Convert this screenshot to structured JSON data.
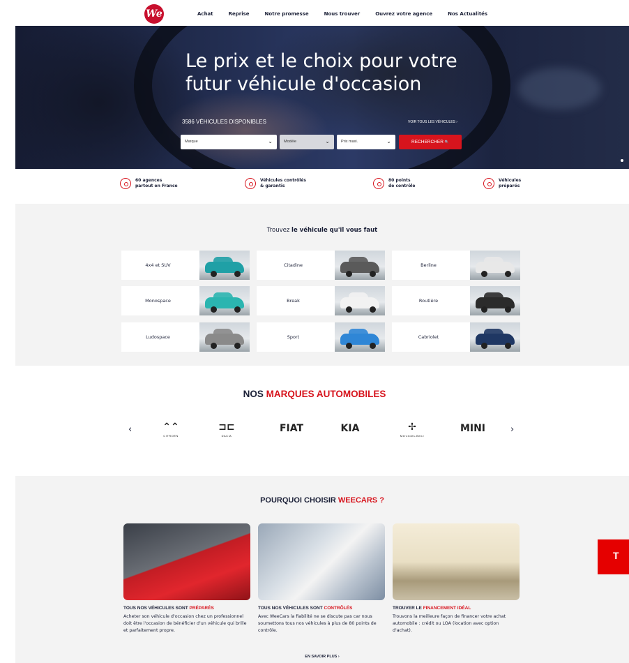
{
  "header": {
    "logo_text": "We",
    "nav": [
      "Achat",
      "Reprise",
      "Notre promesse",
      "Nous trouver",
      "Ouvrez votre agence",
      "Nos Actualités"
    ]
  },
  "hero": {
    "title": "Le prix et le choix pour votre\nfutur véhicule d'occasion",
    "count_label": "3586 VÉHICULES DISPONIBLES",
    "see_all_label": "VOIR TOUS LES VÉHICULES ›",
    "filters": {
      "brand": "Marque",
      "model": "Modèle",
      "max_price": "Prix maxi."
    },
    "search_label": "RECHERCHER",
    "search_icon": "🔍"
  },
  "features": [
    {
      "icon": "target-icon",
      "text": "60 agences\npartout en France"
    },
    {
      "icon": "check-circle-icon",
      "text": "Véhicules contrôlés\n& garantis"
    },
    {
      "icon": "gauge-icon",
      "text": "80 points\nde contrôle"
    },
    {
      "icon": "car-sparkle-icon",
      "text": "Véhicules\npréparés"
    }
  ],
  "categories": {
    "title_plain": "Trouvez ",
    "title_bold": "le véhicule qu'il vous faut",
    "items": [
      {
        "label": "4x4 et SUV",
        "color": "#1fa0a6"
      },
      {
        "label": "Citadine",
        "color": "#5a5a5a"
      },
      {
        "label": "Berline",
        "color": "#e8e8e8"
      },
      {
        "label": "Monospace",
        "color": "#2bb5b0"
      },
      {
        "label": "Break",
        "color": "#f2f2f2"
      },
      {
        "label": "Routière",
        "color": "#2b2b2b"
      },
      {
        "label": "Ludospace",
        "color": "#8a8a8a"
      },
      {
        "label": "Sport",
        "color": "#2f86d6"
      },
      {
        "label": "Cabriolet",
        "color": "#1f3763"
      }
    ]
  },
  "brands": {
    "title_plain": "NOS ",
    "title_red": "MARQUES AUTOMOBILES",
    "prev": "‹",
    "next": "›",
    "items": [
      {
        "mark": "⌃⌃",
        "name": "CITROËN"
      },
      {
        "mark": "⊐⊏",
        "name": "DACIA"
      },
      {
        "mark": "FIAT",
        "name": ""
      },
      {
        "mark": "KIA",
        "name": ""
      },
      {
        "mark": "✢",
        "name": "Mercedes-Benz"
      },
      {
        "mark": "MINI",
        "name": ""
      }
    ]
  },
  "why": {
    "title_plain": "POURQUOI CHOISIR ",
    "title_red": "WEECARS ?",
    "cards": [
      {
        "head_plain": "TOUS NOS VÉHICULES SONT ",
        "head_red": "PRÉPARÉS",
        "text": "Acheter son véhicule d'occasion chez un professionnel doit être l'occasion de bénéficier d'un véhicule qui brille et parfaitement propre."
      },
      {
        "head_plain": "TOUS NOS VÉHICULES SONT ",
        "head_red": "CONTRÔLÉS",
        "text": "Avec WeeCars la fiabilité ne se discute pas car nous soumettons tous nos véhicules à plus de 80 points de contrôle."
      },
      {
        "head_plain": "TROUVER LE ",
        "head_red": "FINANCEMENT IDÉAL",
        "text": "Trouvons la meilleure façon de financer votre achat automobile : crédit ou LOA (location avec option d'achat)."
      }
    ],
    "more_label": "EN SAVOIR PLUS ›"
  },
  "side_tab": {
    "text": "T"
  }
}
